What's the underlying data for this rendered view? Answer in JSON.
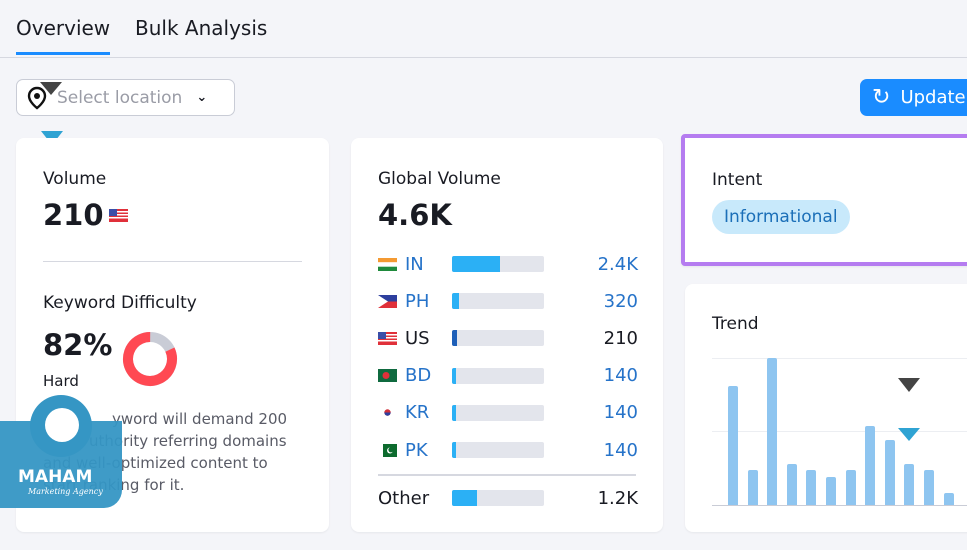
{
  "tabs": [
    {
      "label": "Overview",
      "active": true
    },
    {
      "label": "Bulk Analysis",
      "active": false
    }
  ],
  "location_select": {
    "placeholder": "Select location",
    "icon": "map-pin-icon"
  },
  "update_button": {
    "label": "Update",
    "icon": "refresh-icon"
  },
  "volume": {
    "label": "Volume",
    "value": "210",
    "flag": "US"
  },
  "keyword_difficulty": {
    "label": "Keyword Difficulty",
    "value": "82%",
    "percent": 82,
    "level": "Hard",
    "description": "This keyword will demand 200 high-authority referring domains and well-optimized content to start ranking for it.",
    "visible_description": [
      "yword will demand 200",
      "uthority referring domains",
      "and well-optimized content to",
      "start ranking for it."
    ],
    "color": "#ff4953"
  },
  "global_volume": {
    "label": "Global Volume",
    "value": "4.6K",
    "countries": [
      {
        "code": "IN",
        "value": "2.4K",
        "fill": 52
      },
      {
        "code": "PH",
        "value": "320",
        "fill": 8
      },
      {
        "code": "US",
        "value": "210",
        "fill": 5
      },
      {
        "code": "BD",
        "value": "140",
        "fill": 4
      },
      {
        "code": "KR",
        "value": "140",
        "fill": 4
      },
      {
        "code": "PK",
        "value": "140",
        "fill": 4
      }
    ],
    "other": {
      "label": "Other",
      "value": "1.2K",
      "fill": 27
    }
  },
  "intent": {
    "label": "Intent",
    "badge": "Informational"
  },
  "trend": {
    "label": "Trend",
    "values": [
      0.81,
      0.24,
      1,
      0.28,
      0.24,
      0.19,
      0.24,
      0.54,
      0.44,
      0.28,
      0.24,
      0.08
    ]
  },
  "watermark": {
    "name": "MAHAM",
    "tagline": "Marketing Agency"
  },
  "colors": {
    "accent": "#1a8cff",
    "intent_border": "#b57cf0",
    "bar": "#8ec5f0"
  }
}
